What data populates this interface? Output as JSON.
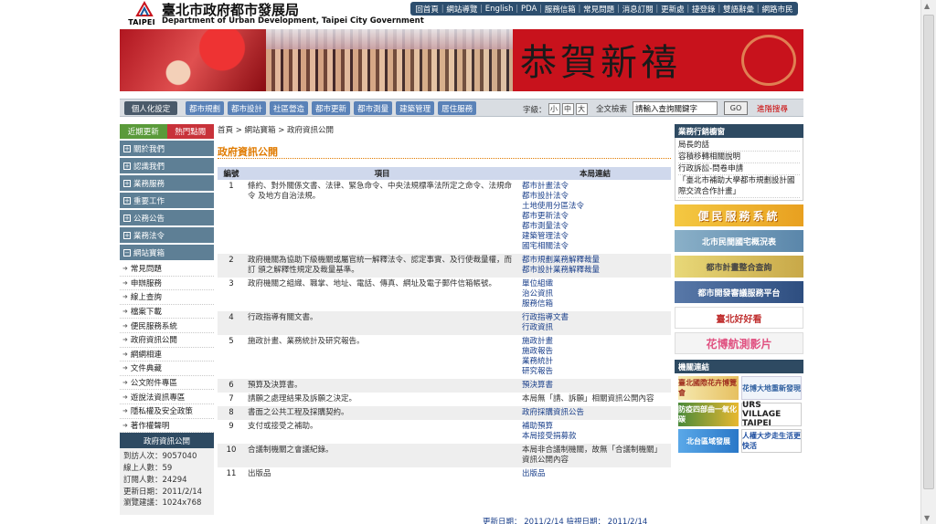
{
  "header": {
    "logo_text": "TAIPEI",
    "title_zh": "臺北市政府都市發展局",
    "title_en": "Department of Urban Development, Taipei City Government",
    "top_links": [
      "回首頁",
      "網站導覽",
      "English",
      "PDA",
      "服務信箱",
      "常見問題",
      "消息訂閱",
      "更新處",
      "捷登錄",
      "雙語辭彙",
      "網路市民"
    ]
  },
  "banner": {
    "greeting": "恭賀新禧"
  },
  "navbar": {
    "personal": "個人化設定",
    "links": [
      "都市規劃",
      "都市設計",
      "社區營造",
      "都市更新",
      "都市測量",
      "建築管理",
      "居住服務"
    ],
    "font_label": "字級：",
    "font_sizes": [
      "小",
      "中",
      "大"
    ],
    "search_label": "全文檢索",
    "search_value": "請輸入查詢關鍵字",
    "go": "GO",
    "advanced": "進階搜尋"
  },
  "sidebar": {
    "tab_latest": "近期更新",
    "tab_hot": "熱門點閱",
    "main_items": [
      "關於我們",
      "認識我們",
      "業務服務",
      "重要工作",
      "公務公告",
      "業務法令",
      "網站寶箱"
    ],
    "sub_items": [
      "常見問題",
      "申辦服務",
      "線上查詢",
      "檔案下載",
      "便民服務系統",
      "政府資訊公開",
      "網網相連",
      "文件典藏",
      "公文附件專區",
      "遊說法資訊專區",
      "隱私權及安全政策",
      "著作權聲明"
    ],
    "active": "政府資訊公開",
    "stats": [
      "到訪人次：9057040",
      "線上人數：59",
      "訂閱人數：24294",
      "更新日期：2011/2/14",
      "瀏覽建議：1024x768"
    ]
  },
  "main": {
    "breadcrumb": "首頁 > 網站寶箱 > 政府資訊公開",
    "title": "政府資訊公開",
    "headers": [
      "編號",
      "項目",
      "本局連結"
    ],
    "rows": [
      {
        "num": "1",
        "item": "條約、對外關係文書、法律、緊急命令、中央法規標準法所定之命令、法規命令 及地方自治法規。",
        "links": [
          "都市計畫法令",
          "都市設計法令",
          "土地使用分區法令",
          "都市更新法令",
          "都市測量法令",
          "建築管理法令",
          "國宅相關法令"
        ]
      },
      {
        "num": "2",
        "item": "政府機關為協助下級機關或屬官統一解釋法令、認定事實、及行使裁量權，而訂 頒之解釋性規定及裁量基準。",
        "links": [
          "都市規劃業務解釋裁量",
          "都市設計業務解釋裁量"
        ]
      },
      {
        "num": "3",
        "item": "政府機關之組織、職掌、地址、電話、傳真、網址及電子郵件信箱帳號。",
        "links": [
          "單位組織",
          "治公資訊",
          "服務信箱"
        ]
      },
      {
        "num": "4",
        "item": "行政指導有關文書。",
        "links": [
          "行政指導文書",
          "行政資訊"
        ]
      },
      {
        "num": "5",
        "item": "施政計畫、業務統計及研究報告。",
        "links": [
          "施政計畫",
          "施政報告",
          "業務統計",
          "研究報告"
        ]
      },
      {
        "num": "6",
        "item": "預算及決算書。",
        "links": [
          "預決算書"
        ]
      },
      {
        "num": "7",
        "item": "請願之處理結果及訴願之決定。",
        "links": [],
        "note": "本局無「請、訴願」相關資訊公開內容"
      },
      {
        "num": "8",
        "item": "書面之公共工程及採購契約。",
        "links": [
          "政府採購資訊公告"
        ]
      },
      {
        "num": "9",
        "item": "支付或接受之補助。",
        "links": [
          "補助預算",
          "本局接受捐募款"
        ]
      },
      {
        "num": "10",
        "item": "合議制機關之會議紀錄。",
        "links": [],
        "note": "本局非合議制機關，故無「合議制機關」資訊公開內容"
      },
      {
        "num": "11",
        "item": "出版品",
        "links": [
          "出版品"
        ]
      }
    ],
    "updated": "更新日期： 2011/2/14   檢視日期： 2011/2/14"
  },
  "right": {
    "heading": "業務行銷櫥窗",
    "list": [
      "局長的話",
      "容積移轉相關說明",
      "行政訴訟-問卷申請",
      "「臺北市補助大學都市規劃設計國際交流合作計畫」"
    ],
    "banners": [
      "便民服務系統",
      "北市民間國宅概況表",
      "都市計畫整合查詢",
      "都市開發審議服務平台",
      "臺北好好看",
      "花博航測影片"
    ],
    "org_heading": "機關連結",
    "orgs": [
      "臺北國際花卉博覽會",
      "花博大地重新發現",
      "防疫四部曲一氧化碳",
      "URS VILLAGE TAIPEI",
      "北台區域發展",
      "人權大步走生活更快活"
    ]
  }
}
